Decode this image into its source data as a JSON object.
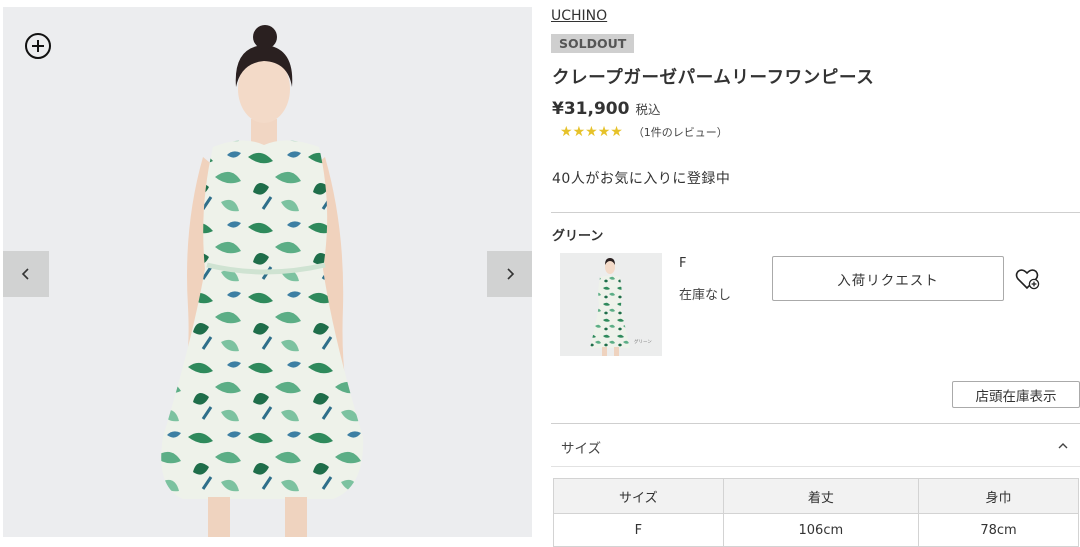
{
  "gallery": {
    "zoom_icon": "plus-circle-icon",
    "prev_icon": "chevron-left-icon",
    "next_icon": "chevron-right-icon"
  },
  "product": {
    "brand": "UCHINO",
    "badge": "SOLDOUT",
    "title": "クレープガーゼパームリーフワンピース",
    "price": "¥31,900",
    "tax_label": "税込",
    "rating": 5,
    "rating_max": 5,
    "review_text": "（1件のレビュー）",
    "star_color": "#e6c22a",
    "favorite_text": "40人がお気に入りに登録中"
  },
  "variant": {
    "color_name": "グリーン",
    "size": "F",
    "stock_status": "在庫なし",
    "restock_button": "入荷リクエスト",
    "favorite_icon": "heart-plus-icon",
    "thumb_caption": "グリーン"
  },
  "store_stock_button": "店頭在庫表示",
  "size_section": {
    "label": "サイズ",
    "toggle_icon": "chevron-up-icon",
    "table": {
      "headers": [
        "サイズ",
        "着丈",
        "身巾"
      ],
      "rows": [
        [
          "F",
          "106cm",
          "78cm"
        ]
      ]
    }
  }
}
